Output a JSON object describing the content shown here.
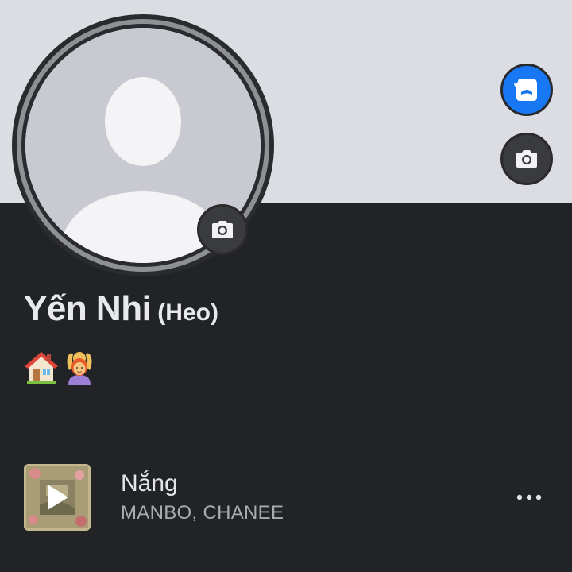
{
  "profile": {
    "name": "Yến Nhi",
    "alternate_name": "(Heo)",
    "bio_emojis": [
      "house-emoji",
      "woman-gesturing-ok-emoji"
    ]
  },
  "profile_music": {
    "title": "Nắng",
    "artists": "MANBO, CHANEE"
  },
  "icons": {
    "avatar_button": "avatar-icon",
    "cover_camera": "camera-icon",
    "profile_camera": "camera-icon",
    "play": "play-icon",
    "more": "more-horizontal-icon"
  },
  "colors": {
    "cover": "#dcdde2",
    "background": "#222326",
    "accent": "#1877f2",
    "primary_text": "#e8e9ec",
    "secondary_text": "#a9abb0"
  }
}
